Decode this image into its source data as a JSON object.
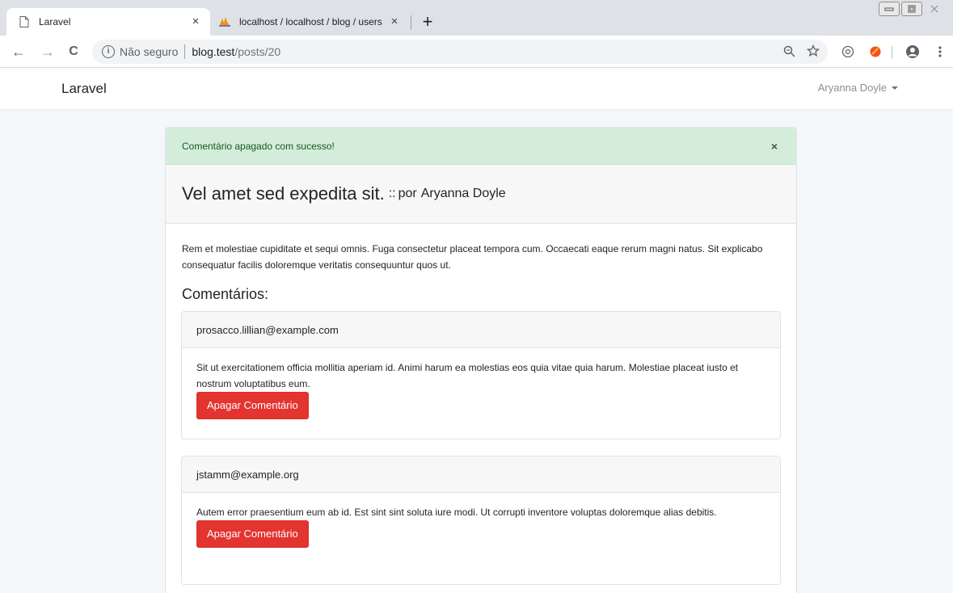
{
  "browser": {
    "tabs": [
      {
        "title": "Laravel",
        "icon": "page-icon",
        "active": true
      },
      {
        "title": "localhost / localhost / blog / users",
        "icon": "phpmyadmin-icon",
        "active": false
      }
    ],
    "new_tab": "+",
    "tab_close": "×",
    "nav": {
      "back": "←",
      "forward": "→",
      "reload": "C"
    },
    "address": {
      "security": "Não seguro",
      "host": "blog.test",
      "path": "/posts/20"
    }
  },
  "navbar": {
    "brand": "Laravel",
    "user": "Aryanna Doyle"
  },
  "alert": {
    "message": "Comentário apagado com sucesso!",
    "close": "×",
    "color": "#d4edda"
  },
  "post": {
    "title": "Vel amet sed expedita sit.",
    "separator": "::",
    "by": "por",
    "author": "Aryanna Doyle",
    "body": "Rem et molestiae cupiditate et sequi omnis. Fuga consectetur placeat tempora cum. Occaecati eaque rerum magni natus. Sit explicabo consequatur facilis doloremque veritatis consequuntur quos ut."
  },
  "comments_heading": "Comentários:",
  "comments": [
    {
      "email": "prosacco.lillian@example.com",
      "body": "Sit ut exercitationem officia mollitia aperiam id. Animi harum ea molestias eos quia vitae quia harum. Molestiae placeat iusto et nostrum voluptatibus eum.",
      "delete_label": "Apagar Comentário"
    },
    {
      "email": "jstamm@example.org",
      "body": "Autem error praesentium eum ab id. Est sint sint soluta iure modi. Ut corrupti inventore voluptas doloremque alias debitis.",
      "delete_label": "Apagar Comentário"
    }
  ],
  "colors": {
    "danger": "#e3342f",
    "success_bg": "#d4edda",
    "page_bg": "#f5f8fa"
  }
}
